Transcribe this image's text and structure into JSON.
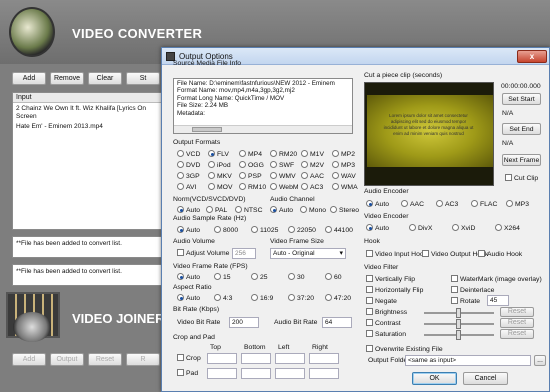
{
  "app": {
    "title": "VIDEO CONVERTER",
    "joiner_title": "VIDEO JOINER",
    "toolbar": [
      "Add",
      "Remove",
      "Clear",
      "St"
    ],
    "list_header": "Input",
    "list_items": [
      "2 Chainz We Own It ft. Wiz Khalifa [Lyrics On Screen",
      "Hate Em' - Eminem 2013.mp4"
    ],
    "log1": "**File has been added to convert list.",
    "log2": "**File has been added to convert list.",
    "joiner_toolbar": [
      "Add",
      "Output",
      "Reset",
      "R"
    ]
  },
  "dialog": {
    "title": "Output Options",
    "close": "x",
    "source_info": {
      "label": "Source Media File Info",
      "lines": [
        "File Name: D:\\eminem\\fastnfurious\\NEW 2012 - Eminem",
        "Format Name: mov,mp4,m4a,3gp,3g2,mj2",
        "Format Long Name: QuickTime / MOV",
        "File Size: 2.24 MB",
        "Metadata:"
      ]
    },
    "cut_clip": {
      "label": "Cut a piece clip (seconds)",
      "time": "00:00:00.000",
      "set_start": "Set Start",
      "start_val": "N/A",
      "set_end": "Set End",
      "end_val": "N/A",
      "next_frame": "Next Frame",
      "cut_clip_chk": "Cut Clip",
      "preview_text": "Lorem ipsum dolor sit amet consectetur adipiscing elit sed do eiusmod tempor incididunt ut labore et dolore magna aliqua ut enim ad minim veniam quis nostrud"
    },
    "output_formats": {
      "label": "Output Formats",
      "items": [
        "VCD",
        "FLV",
        "MP4",
        "RM20",
        "M1V",
        "MP2",
        "DVD",
        "iPod",
        "OGG",
        "SWF",
        "M2V",
        "MP3",
        "3GP",
        "MKV",
        "PSP",
        "WMV",
        "AAC",
        "WAV",
        "AVI",
        "MOV",
        "RM10",
        "WebM",
        "AC3",
        "WMA"
      ],
      "selected": "FLV"
    },
    "norm": {
      "label": "Norm(VCD/SVCD/DVD)",
      "items": [
        "Auto",
        "PAL",
        "NTSC"
      ],
      "selected": "Auto"
    },
    "audio_channel": {
      "label": "Audio Channel",
      "items": [
        "Auto",
        "Mono",
        "Stereo"
      ],
      "selected": "Auto"
    },
    "sample_rate": {
      "label": "Audio Sample Rate (Hz)",
      "items": [
        "Auto",
        "8000",
        "11025",
        "22050",
        "44100"
      ],
      "selected": "Auto"
    },
    "audio_volume": {
      "label": "Audio Volume",
      "adjust": "Adjust Volume",
      "value": "256"
    },
    "frame_size": {
      "label": "Video Frame Size",
      "value": "Auto - Original"
    },
    "frame_rate": {
      "label": "Video Frame Rate (FPS)",
      "items": [
        "Auto",
        "15",
        "25",
        "30",
        "60"
      ],
      "selected": "Auto"
    },
    "aspect": {
      "label": "Aspect Ratio",
      "items": [
        "Auto",
        "4:3",
        "16:9",
        "37:20",
        "47:20"
      ],
      "selected": "Auto"
    },
    "bitrate": {
      "label": "Bit Rate (Kbps)",
      "video_label": "Video Bit Rate",
      "video_value": "200",
      "audio_label": "Audio Bit Rate",
      "audio_value": "64"
    },
    "crop": {
      "label": "Crop and Pad",
      "cols": [
        "Top",
        "Bottom",
        "Left",
        "Right"
      ],
      "rows": [
        "Crop",
        "Pad"
      ]
    },
    "audio_encoder": {
      "label": "Audio Encoder",
      "items": [
        "Auto",
        "AAC",
        "AC3",
        "FLAC",
        "MP3"
      ],
      "selected": "Auto"
    },
    "video_encoder": {
      "label": "Video Encoder",
      "items": [
        "Auto",
        "DivX",
        "XviD",
        "X264"
      ],
      "selected": "Auto"
    },
    "hook": {
      "label": "Hook",
      "items": [
        "Video Input Hook",
        "Video Output Hook",
        "Audio Hook"
      ]
    },
    "video_filter": {
      "label": "Video Filter",
      "left": [
        "Vertically Flip",
        "Horizontally Flip",
        "Negate"
      ],
      "right": [
        "WaterMark (image overlay)",
        "Deinterlace",
        "Rotate"
      ],
      "rotate_value": "45",
      "sliders": [
        "Brightness",
        "Contrast",
        "Saturation"
      ],
      "reset": "Reset"
    },
    "overwrite": "Overwrite Existing File",
    "output_folder_label": "Output Folder",
    "output_folder_value": "<same as input>",
    "browse": "...",
    "ok": "OK",
    "cancel": "Cancel"
  }
}
